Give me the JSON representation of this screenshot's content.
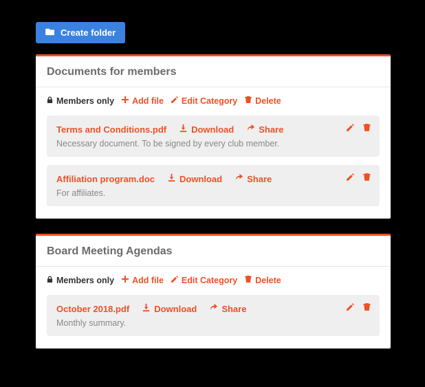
{
  "createFolder": {
    "label": "Create folder"
  },
  "toolbar": {
    "membersOnly": "Members only",
    "addFile": "Add file",
    "editCategory": "Edit Category",
    "delete": "Delete"
  },
  "fileActions": {
    "download": "Download",
    "share": "Share"
  },
  "panels": [
    {
      "title": "Documents for members",
      "files": [
        {
          "name": "Terms and Conditions.pdf",
          "desc": "Necessary document. To be signed by every club member."
        },
        {
          "name": "Affiliation program.doc",
          "desc": "For affiliates."
        }
      ]
    },
    {
      "title": "Board Meeting Agendas",
      "files": [
        {
          "name": "October 2018.pdf",
          "desc": "Monthly summary."
        }
      ]
    }
  ]
}
